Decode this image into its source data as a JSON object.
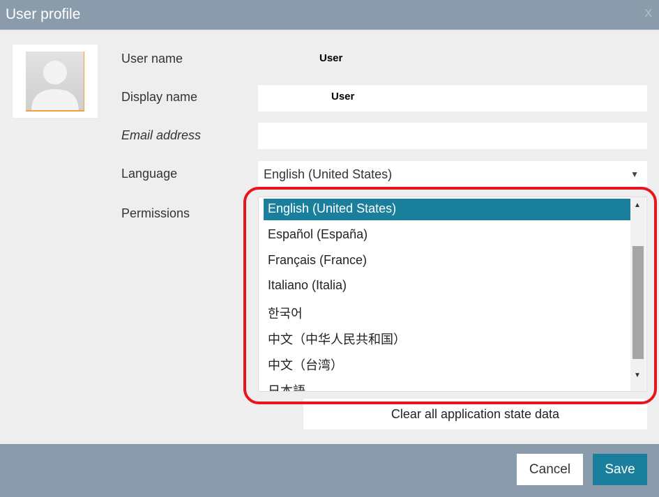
{
  "dialog": {
    "title": "User profile",
    "close": "X"
  },
  "form": {
    "user_name_label": "User name",
    "user_name_value": "User",
    "display_name_label": "Display name",
    "display_name_value": "User",
    "email_label": "Email address",
    "email_value": "",
    "language_label": "Language",
    "language_value": "English (United States)",
    "permissions_label": "Permissions"
  },
  "language_options": [
    "English (United States)",
    "Español (España)",
    "Français (France)",
    "Italiano (Italia)",
    "한국어",
    "中文（中华人民共和国）",
    "中文（台湾）",
    "日本語"
  ],
  "clear_button": "Clear all application state data",
  "footer": {
    "cancel": "Cancel",
    "save": "Save"
  },
  "colors": {
    "header": "#8a9cab",
    "accent": "#1a7f9c",
    "highlight_ring": "#e8141e"
  }
}
